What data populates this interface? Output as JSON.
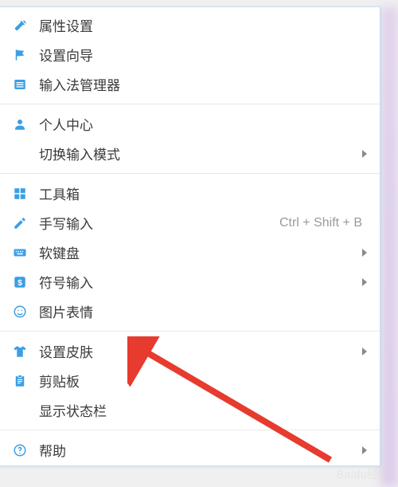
{
  "menu": {
    "groups": [
      {
        "items": [
          {
            "id": "properties",
            "icon": "wrench-icon",
            "label": "属性设置"
          },
          {
            "id": "wizard",
            "icon": "flag-icon",
            "label": "设置向导"
          },
          {
            "id": "ime-manager",
            "icon": "list-icon",
            "label": "输入法管理器"
          }
        ]
      },
      {
        "items": [
          {
            "id": "user-center",
            "icon": "user-icon",
            "label": "个人中心"
          },
          {
            "id": "switch-mode",
            "icon": "",
            "label": "切换输入模式",
            "submenu": true
          }
        ]
      },
      {
        "items": [
          {
            "id": "toolbox",
            "icon": "grid-icon",
            "label": "工具箱"
          },
          {
            "id": "handwrite",
            "icon": "pencil-icon",
            "label": "手写输入",
            "shortcut": "Ctrl + Shift + B"
          },
          {
            "id": "soft-keyboard",
            "icon": "keyboard-icon",
            "label": "软键盘",
            "submenu": true
          },
          {
            "id": "symbols",
            "icon": "dollar-icon",
            "label": "符号输入",
            "submenu": true
          },
          {
            "id": "emoji",
            "icon": "smile-icon",
            "label": "图片表情"
          }
        ]
      },
      {
        "items": [
          {
            "id": "skin",
            "icon": "shirt-icon",
            "label": "设置皮肤",
            "submenu": true
          },
          {
            "id": "clipboard",
            "icon": "clipboard-icon",
            "label": "剪贴板"
          },
          {
            "id": "statusbar",
            "icon": "",
            "label": "显示状态栏"
          }
        ]
      },
      {
        "items": [
          {
            "id": "help",
            "icon": "help-icon",
            "label": "帮助",
            "submenu": true
          }
        ]
      }
    ]
  },
  "colors": {
    "icon": "#3b9fe4",
    "arrow": "#e63b2e"
  },
  "watermark": "Baidu经验"
}
